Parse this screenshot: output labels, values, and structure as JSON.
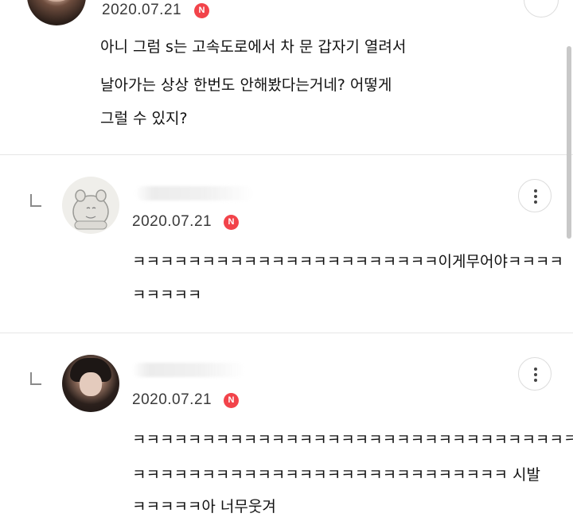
{
  "comments": [
    {
      "date": "2020.07.21",
      "badge": "N",
      "lines": [
        "아니 그럼 s는 고속도로에서 차 문 갑자기 열려서",
        "날아가는 상상 한번도 안해봤다는거네? 어떻게",
        "그럴 수 있지?"
      ],
      "avatar": "profile-photo"
    },
    {
      "date": "2020.07.21",
      "badge": "N",
      "is_reply": true,
      "lines": [
        "ㅋㅋㅋㅋㅋㅋㅋㅋㅋㅋㅋㅋㅋㅋㅋㅋㅋㅋㅋㅋㅋㅋ이게무어야ㅋㅋㅋㅋ",
        "ㅋㅋㅋㅋㅋ"
      ],
      "avatar": "character-avatar",
      "more_icon": "more-vertical-icon"
    },
    {
      "date": "2020.07.21",
      "badge": "N",
      "is_reply": true,
      "lines": [
        "ㅋㅋㅋㅋㅋㅋㅋㅋㅋㅋㅋㅋㅋㅋㅋㅋㅋㅋㅋㅋㅋㅋㅋㅋㅋㅋㅋㅋㅋㅋㅋㅋ",
        "ㅋㅋㅋㅋㅋㅋㅋㅋㅋㅋㅋㅋㅋㅋㅋㅋㅋㅋㅋㅋㅋㅋㅋㅋㅋㅋㅋ 시발",
        "ㅋㅋㅋㅋㅋ아 너무웃겨"
      ],
      "avatar": "profile-photo",
      "more_icon": "more-vertical-icon"
    }
  ],
  "colors": {
    "badge": "#f2434a",
    "divider": "#e6e6e6",
    "date": "#3a3a3a"
  }
}
